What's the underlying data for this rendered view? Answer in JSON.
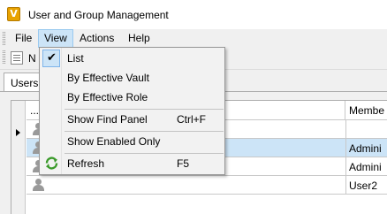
{
  "window": {
    "title": "User and Group Management",
    "app_icon_letter": "V",
    "app_icon": "vault-app-icon"
  },
  "menubar": {
    "items": [
      "File",
      "View",
      "Actions",
      "Help"
    ],
    "active": "View"
  },
  "toolbar": {
    "new_label_partial": "N",
    "icon": "new-user-icon"
  },
  "tabs": [
    "Users"
  ],
  "grid": {
    "headers": [
      "...",
      "",
      "Membe"
    ],
    "rows": [
      {
        "member": "",
        "selected": false
      },
      {
        "member": "Admini",
        "selected": true
      },
      {
        "member": "Admini",
        "selected": false
      },
      {
        "member": "User2",
        "selected": false
      }
    ]
  },
  "view_menu": {
    "items": [
      {
        "label": "List",
        "checked": true,
        "shortcut": ""
      },
      {
        "label": "By Effective Vault",
        "checked": false,
        "shortcut": ""
      },
      {
        "label": "By Effective Role",
        "checked": false,
        "shortcut": ""
      },
      {
        "label": "Show Find Panel",
        "checked": false,
        "shortcut": "Ctrl+F"
      },
      {
        "label": "Show Enabled Only",
        "checked": false,
        "shortcut": ""
      },
      {
        "label": "Refresh",
        "checked": false,
        "shortcut": "F5",
        "icon": "refresh-icon"
      }
    ]
  },
  "colors": {
    "menu_highlight": "#cce4f7",
    "menu_highlight_border": "#99c9ef",
    "row_selected": "#cce4f7",
    "app_icon": "#e8a200",
    "refresh_icon": "#3a9a2a"
  }
}
